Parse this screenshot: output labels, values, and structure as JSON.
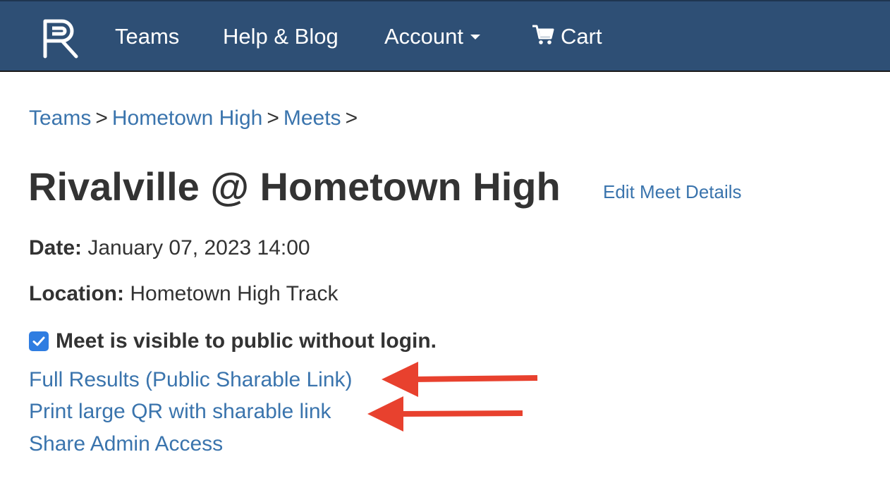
{
  "navbar": {
    "logo_text": "R",
    "items": [
      {
        "label": "Teams"
      },
      {
        "label": "Help & Blog"
      },
      {
        "label": "Account"
      },
      {
        "label": "Cart"
      }
    ]
  },
  "breadcrumb": {
    "items": [
      "Teams",
      "Hometown High",
      "Meets"
    ],
    "separator": ">"
  },
  "meet": {
    "title": "Rivalville @ Hometown High",
    "edit_label": "Edit Meet Details",
    "date_label": "Date:",
    "date_value": "January 07, 2023 14:00",
    "location_label": "Location:",
    "location_value": "Hometown High Track",
    "visibility_label": "Meet is visible to public without login.",
    "visibility_checked": true
  },
  "links": {
    "full_results": "Full Results (Public Sharable Link)",
    "print_qr": "Print large QR with sharable link",
    "share_admin": "Share Admin Access"
  },
  "annotations": {
    "arrow_color": "#e8412e",
    "arrow_count": 2
  },
  "colors": {
    "navbar_bg": "#2e4f75",
    "link": "#3a74ad",
    "checkbox": "#2f7de1"
  }
}
